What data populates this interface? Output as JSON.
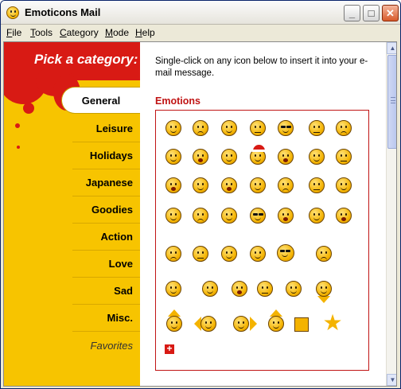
{
  "window": {
    "title": "Emoticons Mail",
    "buttons": {
      "minimize": "_",
      "maximize": "□",
      "close": "✕"
    }
  },
  "menu": [
    "File",
    "Tools",
    "Category",
    "Mode",
    "Help"
  ],
  "sidebar": {
    "heading": "Pick a category:",
    "selected": "General",
    "items": [
      "Leisure",
      "Holidays",
      "Japanese",
      "Goodies",
      "Action",
      "Love",
      "Sad",
      "Misc.",
      "Favorites"
    ]
  },
  "main": {
    "instructions": "Single-click on any icon below to insert it into your e-mail message.",
    "section_title": "Emotions",
    "add_symbol": "+"
  },
  "colors": {
    "accent_red": "#d81a14",
    "sidebar_yellow": "#f7c400",
    "section_red": "#c01414"
  }
}
